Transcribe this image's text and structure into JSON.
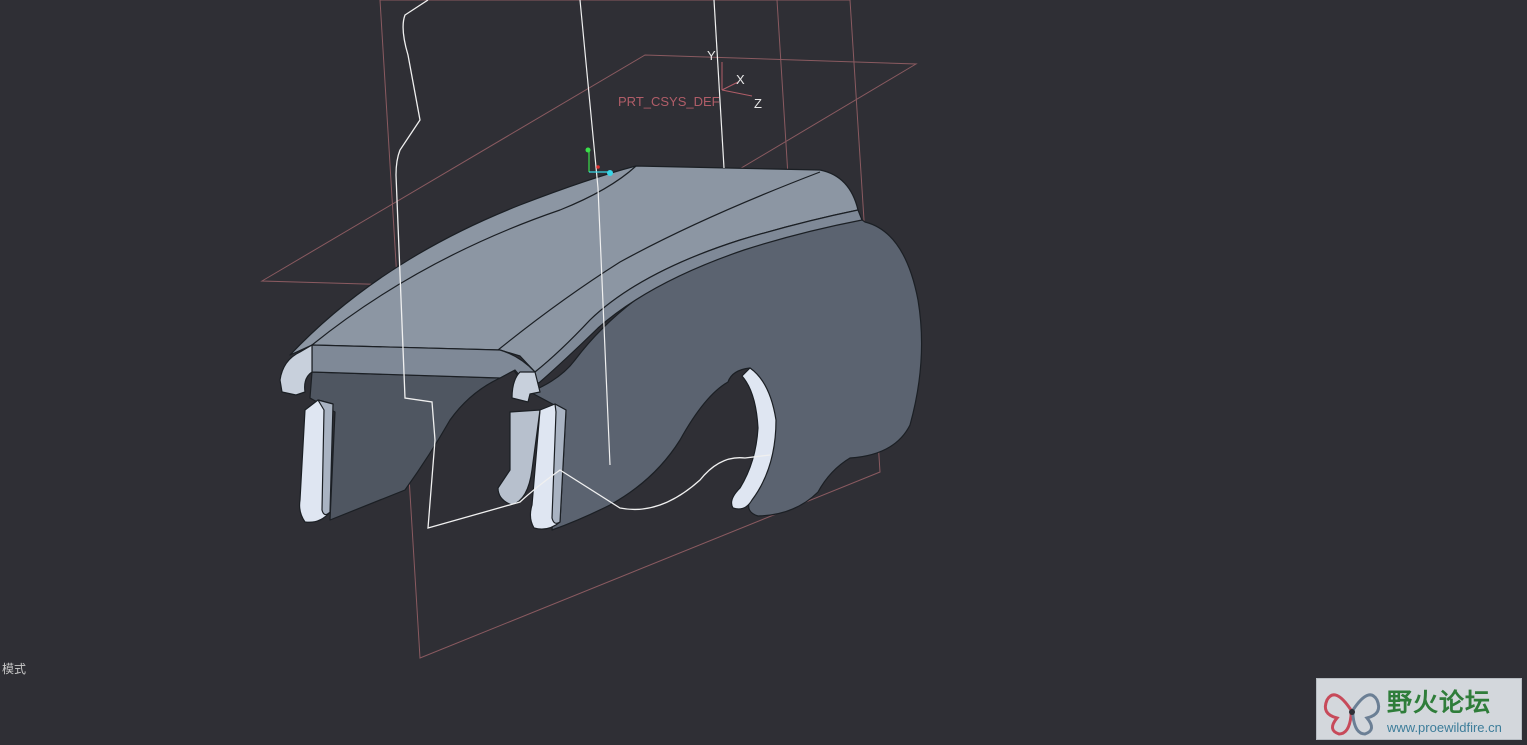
{
  "viewport": {
    "background": "#2f2f35",
    "datum_plane_color": "#8a5a60",
    "model_body_color": "#5b6370",
    "model_top_color": "#8c96a3",
    "edge_color": "#1d2126"
  },
  "csys": {
    "name": "PRT_CSYS_DEF",
    "axis_x": "X",
    "axis_y": "Y",
    "axis_z": "Z"
  },
  "status": {
    "mode": "模式"
  },
  "watermark": {
    "title": "野火论坛",
    "url": "www.proewildfire.cn",
    "logo_icon": "butterfly-logo-icon"
  }
}
